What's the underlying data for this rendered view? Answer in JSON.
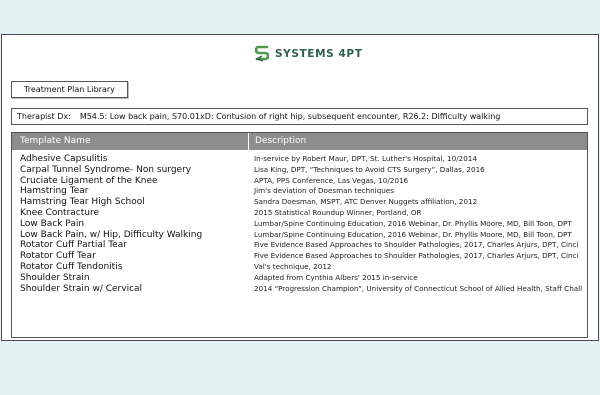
{
  "brand": {
    "name": "SYSTEMS 4PT",
    "color": "#2f5f4f",
    "accent": "#4a9a4a",
    "icon": "systems4pt-logo-icon"
  },
  "library_button": {
    "label": "Treatment Plan Library"
  },
  "diagnosis": {
    "label": "Therapist Dx:",
    "value": "M54.5: Low back pain, S70.01xD: Contusion of right hip, subsequent encounter, R26.2: Difficulty walking"
  },
  "table": {
    "header_color": "#8d8d8d",
    "columns": [
      "Template Name",
      "Description"
    ],
    "rows": [
      {
        "name": "Adhesive Capsulitis",
        "description": "In-service by Robert Maur, DPT, St. Luther's Hospital, 10/2014"
      },
      {
        "name": "Carpal Tunnel Syndrome- Non surgery",
        "description": "Lisa King, DPT, “Techniques to Avoid CTS Surgery”, Dallas, 2016"
      },
      {
        "name": "Cruciate Ligament of the Knee",
        "description": "APTA, PPS Conference, Las Vegas, 10/2016"
      },
      {
        "name": "Hamstring Tear",
        "description": "Jim's deviation of Doesman techniques"
      },
      {
        "name": "Hamstring Tear High School",
        "description": "Sandra Doesman, MSPT, ATC Denver Nuggets affiliation, 2012"
      },
      {
        "name": "Knee Contracture",
        "description": "2015 Statistical Roundup Winner, Portland, OR"
      },
      {
        "name": "Low Back Pain",
        "description": "Lumbar/Spine Continuing Education, 2016 Webinar, Dr. Phyllis Moore, MD,  Bill Toon, DPT"
      },
      {
        "name": "Low Back Pain, w/ Hip, Difficulty Walking",
        "description": "Lumbar/Spine Continuing Education, 2016 Webinar, Dr. Phyllis Moore, MD,  Bill Toon, DPT"
      },
      {
        "name": "Rotator Cuff Partial Tear",
        "description": "Five Evidence Based Approaches to Shoulder Pathologies, 2017, Charles Arjurs, DPT, Cinci"
      },
      {
        "name": "Rotator Cuff Tear",
        "description": "Five Evidence Based Approaches to Shoulder Pathologies, 2017, Charles Arjurs, DPT, Cinci"
      },
      {
        "name": "Rotator Cuff Tendonitis",
        "description": "Val's technique, 2012"
      },
      {
        "name": "Shoulder Strain",
        "description": " Adapted from Cynthia Albers' 2015 in-service"
      },
      {
        "name": "Shoulder Strain w/ Cervical",
        "description": "2014 “Progression Champion”, University of Connecticut School of Allied Health, Staff Chall"
      }
    ]
  }
}
